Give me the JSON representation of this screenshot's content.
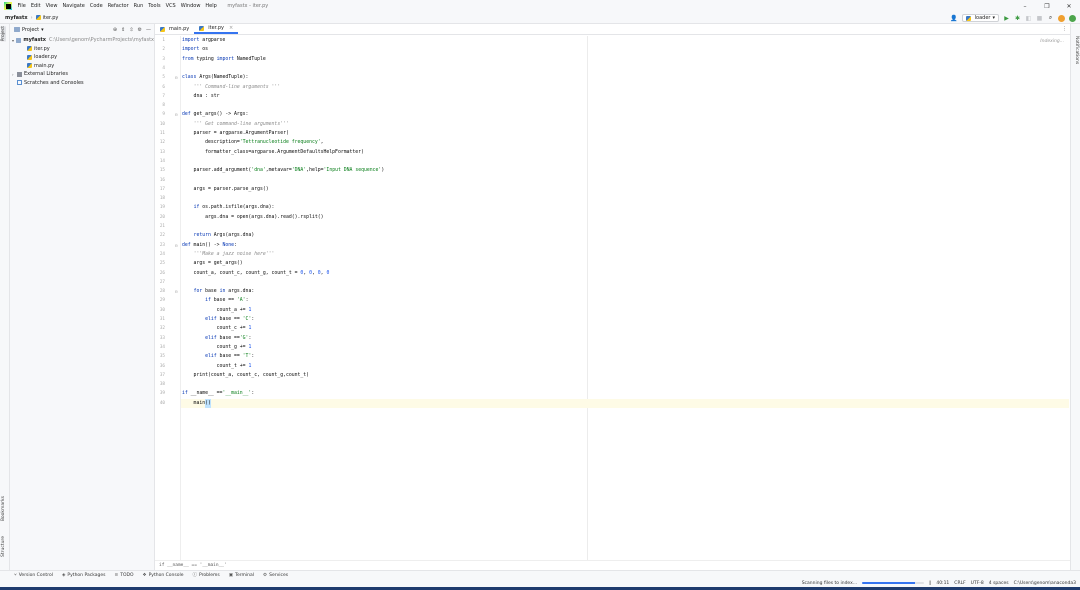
{
  "window": {
    "title": "myfastx - iter.py",
    "controls": [
      "–",
      "❐",
      "✕"
    ]
  },
  "menu": [
    "File",
    "Edit",
    "View",
    "Navigate",
    "Code",
    "Refactor",
    "Run",
    "Tools",
    "VCS",
    "Window",
    "Help"
  ],
  "nav": {
    "project": "myfastx",
    "file": "iter.py",
    "run_config": "loader"
  },
  "project_panel": {
    "title": "Project",
    "tree": {
      "root_name": "myfastx",
      "root_path": "C:\\Users\\genom\\PycharmProjects\\myfastx",
      "files": [
        "iter.py",
        "loader.py",
        "main.py"
      ],
      "external": "External Libraries",
      "scratches": "Scratches and Consoles"
    }
  },
  "editor": {
    "tabs": [
      "main.py",
      "iter.py"
    ],
    "indexing": "Indexing...",
    "breadcrumb": "if __name__ == '__main__'",
    "line_numbers": [
      "1",
      "2",
      "3",
      "4",
      "5",
      "6",
      "7",
      "8",
      "9",
      "10",
      "11",
      "12",
      "13",
      "14",
      "15",
      "16",
      "17",
      "18",
      "19",
      "20",
      "21",
      "22",
      "23",
      "24",
      "25",
      "26",
      "27",
      "28",
      "29",
      "30",
      "31",
      "32",
      "33",
      "34",
      "35",
      "36",
      "37",
      "38",
      "39",
      "40"
    ]
  },
  "left_tabs": [
    "Project",
    "Bookmarks",
    "Structure"
  ],
  "right_tabs": [
    "Notifications"
  ],
  "bottom_tools": [
    "Version Control",
    "Python Packages",
    "TODO",
    "Python Console",
    "Problems",
    "Terminal",
    "Services"
  ],
  "status": {
    "task": "Scanning files to index...",
    "progress": 0.85,
    "position": "40:11",
    "line_sep": "CRLF",
    "encoding": "UTF-8",
    "indent": "4 spaces",
    "interpreter": "C:\\Users\\genom\\anaconda3"
  },
  "colors": {
    "accent": "#3574f0",
    "keyword": "#0033b3",
    "string": "#067d17",
    "docstring": "#8c8c8c",
    "number": "#1750eb"
  }
}
